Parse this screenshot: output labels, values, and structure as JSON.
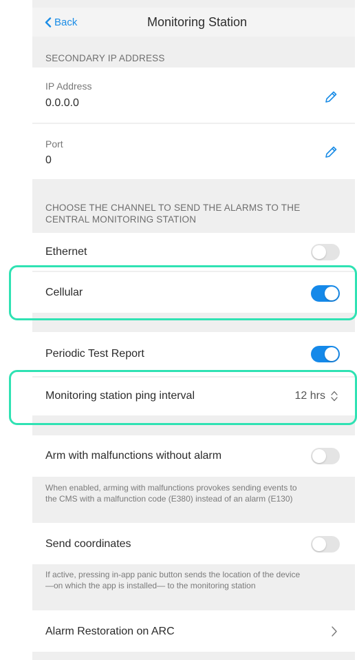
{
  "nav": {
    "back_label": "Back",
    "title": "Monitoring Station"
  },
  "secondary_ip": {
    "header": "SECONDARY IP ADDRESS",
    "ip_label": "IP Address",
    "ip_value": "0.0.0.0",
    "port_label": "Port",
    "port_value": "0"
  },
  "channel": {
    "header_line1": "CHOOSE THE CHANNEL TO SEND THE ALARMS TO THE",
    "header_line2": "CENTRAL MONITORING STATION",
    "ethernet_label": "Ethernet",
    "ethernet_on": false,
    "cellular_label": "Cellular",
    "cellular_on": true
  },
  "periodic": {
    "label": "Periodic Test Report",
    "on": true,
    "ping_label": "Monitoring station ping interval",
    "ping_value": "12 hrs"
  },
  "arm_malfunctions": {
    "label": "Arm with malfunctions without alarm",
    "on": false,
    "desc_line1": "When enabled, arming with malfunctions provokes sending events to",
    "desc_line2": "the CMS with a malfunction code (E380) instead of an alarm (E130)"
  },
  "send_coordinates": {
    "label": "Send coordinates",
    "on": false,
    "desc_line1": "If active, pressing in-app panic button sends the location of the device",
    "desc_line2": "—on which the app is installed— to the monitoring station"
  },
  "alarm_restoration": {
    "label": "Alarm Restoration on ARC"
  },
  "colors": {
    "accent": "#1589e9",
    "highlight": "#2fe2b3",
    "background": "#efefef",
    "toggle_off": "#e4e4e4"
  }
}
